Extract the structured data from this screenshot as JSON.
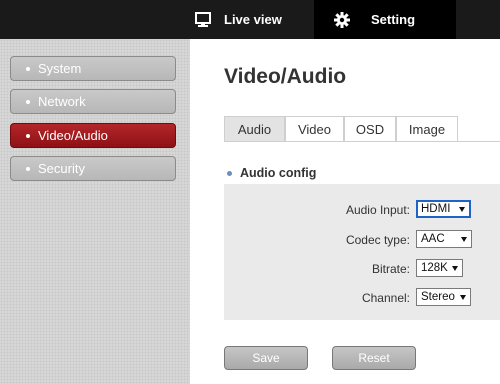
{
  "header": {
    "live_view_label": "Live view",
    "setting_label": "Setting",
    "live_view_icon": "monitor-icon",
    "setting_icon": "gear-icon"
  },
  "sidebar": {
    "items": [
      {
        "label": "System",
        "active": false
      },
      {
        "label": "Network",
        "active": false
      },
      {
        "label": "Video/Audio",
        "active": true
      },
      {
        "label": "Security",
        "active": false
      }
    ]
  },
  "main": {
    "title": "Video/Audio",
    "tabs": [
      {
        "label": "Audio",
        "active": true
      },
      {
        "label": "Video",
        "active": false
      },
      {
        "label": "OSD",
        "active": false
      },
      {
        "label": "Image",
        "active": false
      }
    ],
    "section_title": "Audio config",
    "fields": [
      {
        "label": "Audio Input:",
        "value": "HDMI"
      },
      {
        "label": "Codec type:",
        "value": "AAC"
      },
      {
        "label": "Bitrate:",
        "value": "128K"
      },
      {
        "label": "Channel:",
        "value": "Stereo"
      }
    ],
    "save_label": "Save",
    "reset_label": "Reset"
  },
  "colors": {
    "topbar": "#1a1a1a",
    "active_nav": "#000000",
    "sidebar_active": "#a01a1e",
    "focus_border": "#1f63c7"
  }
}
